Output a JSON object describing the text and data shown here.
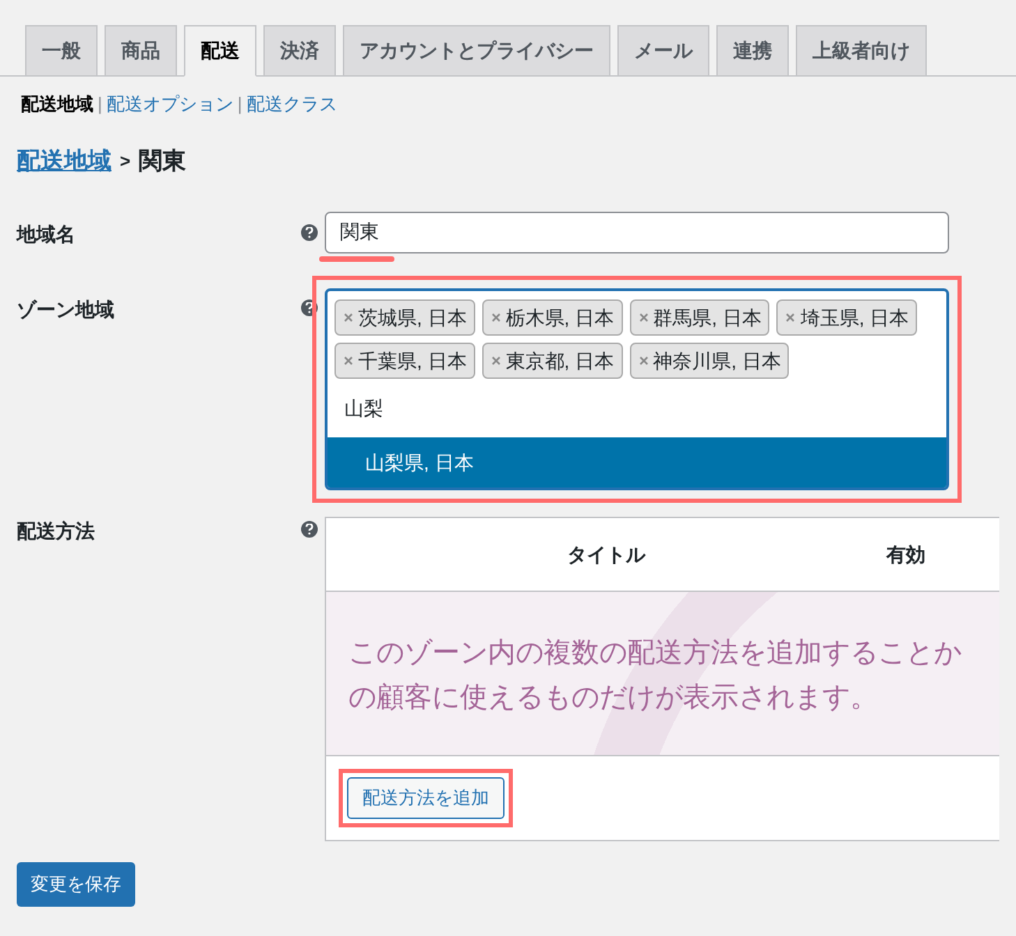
{
  "tabs": [
    {
      "label": "一般",
      "selected": false
    },
    {
      "label": "商品",
      "selected": false
    },
    {
      "label": "配送",
      "selected": true
    },
    {
      "label": "決済",
      "selected": false
    },
    {
      "label": "アカウントとプライバシー",
      "selected": false
    },
    {
      "label": "メール",
      "selected": false
    },
    {
      "label": "連携",
      "selected": false
    },
    {
      "label": "上級者向け",
      "selected": false
    }
  ],
  "subnav": [
    {
      "label": "配送地域",
      "selected": true
    },
    {
      "label": "配送オプション",
      "selected": false
    },
    {
      "label": "配送クラス",
      "selected": false
    }
  ],
  "subnav_separator": "|",
  "breadcrumb": {
    "link": "配送地域",
    "separator": ">",
    "current": "関東"
  },
  "region_name": {
    "label": "地域名",
    "value": "関東",
    "underlined": true
  },
  "zone_regions": {
    "label": "ゾーン地域",
    "highlighted": true,
    "tags": [
      "茨城県, 日本",
      "栃木県, 日本",
      "群馬県, 日本",
      "埼玉県, 日本",
      "千葉県, 日本",
      "東京都, 日本",
      "神奈川県, 日本"
    ],
    "typed": "山梨",
    "options": [
      {
        "label": "山梨県, 日本",
        "selected": true
      }
    ]
  },
  "shipping_methods": {
    "label": "配送方法",
    "columns": [
      "タイトル",
      "有効"
    ],
    "notice_lines": [
      "このゾーン内の複数の配送方法を追加することか",
      "の顧客に使えるものだけが表示されます。"
    ],
    "add_button": {
      "label": "配送方法を追加",
      "highlighted": true
    }
  },
  "save_button": "変更を保存"
}
